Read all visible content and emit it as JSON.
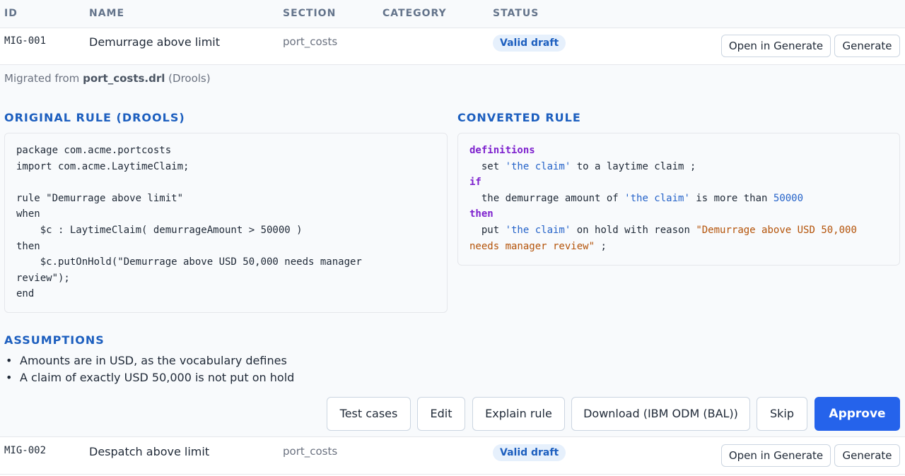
{
  "columns": {
    "id": "ID",
    "name": "NAME",
    "section": "SECTION",
    "category": "CATEGORY",
    "status": "STATUS"
  },
  "rows": [
    {
      "id": "MIG-001",
      "name": "Demurrage above limit",
      "section": "port_costs",
      "category": "",
      "status": "Valid draft",
      "open_label": "Open in Generate",
      "generate_label": "Generate"
    },
    {
      "id": "MIG-002",
      "name": "Despatch above limit",
      "section": "port_costs",
      "category": "",
      "status": "Valid draft",
      "open_label": "Open in Generate",
      "generate_label": "Generate"
    }
  ],
  "detail": {
    "migrated_prefix": "Migrated from",
    "migrated_file": "port_costs.drl",
    "migrated_suffix": "(Drools)",
    "original_title": "ORIGINAL RULE (DROOLS)",
    "original_code": "package com.acme.portcosts\nimport com.acme.LaytimeClaim;\n\nrule \"Demurrage above limit\"\nwhen\n    $c : LaytimeClaim( demurrageAmount > 50000 )\nthen\n    $c.putOnHold(\"Demurrage above USD 50,000 needs manager\nreview\");\nend",
    "converted_title": "CONVERTED RULE",
    "converted": {
      "kw_definitions": "definitions",
      "l1_a": "  set ",
      "l1_str": "'the claim'",
      "l1_b": " to a laytime claim ;",
      "kw_if": "if",
      "l2_a": "  the demurrage amount of ",
      "l2_str": "'the claim'",
      "l2_b": " is more than ",
      "l2_num": "50000",
      "kw_then": "then",
      "l3_a": "  put ",
      "l3_str": "'the claim'",
      "l3_b": " on hold with reason ",
      "l3_str2a": "\"Demurrage above USD 50,000",
      "l4_str2b": "needs manager review\"",
      "l4_b": " ;"
    },
    "assumptions_title": "ASSUMPTIONS",
    "assumptions": [
      "Amounts are in USD, as the vocabulary defines",
      "A claim of exactly USD 50,000 is not put on hold"
    ],
    "actions": {
      "test_cases": "Test cases",
      "edit": "Edit",
      "explain": "Explain rule",
      "download": "Download (IBM ODM (BAL))",
      "skip": "Skip",
      "approve": "Approve"
    }
  },
  "colors": {
    "accent": "#2563eb",
    "section_title": "#1d5fbf",
    "badge_bg": "#e6f0fc",
    "keyword": "#7e22ce",
    "string": "#2563c9",
    "reason_string": "#b45309"
  }
}
